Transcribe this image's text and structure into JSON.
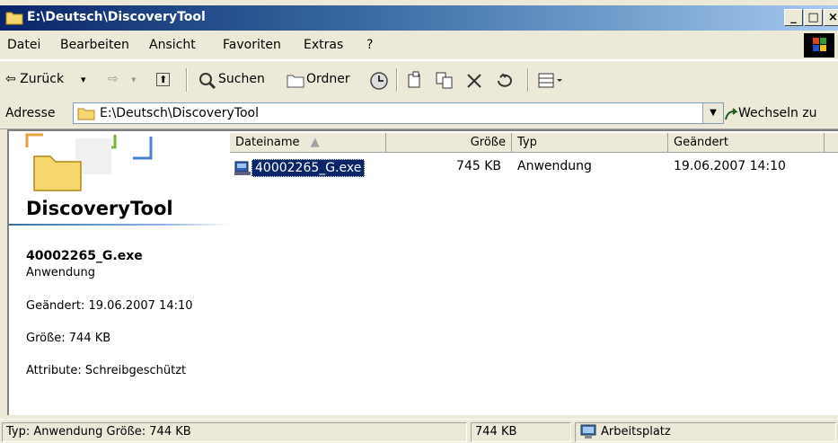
{
  "window": {
    "title": "E:\\Deutsch\\DiscoveryTool",
    "buttons": {
      "minimize": "_",
      "maximize": "□",
      "close": "×"
    }
  },
  "menu": [
    "Datei",
    "Bearbeiten",
    "Ansicht",
    "Favoriten",
    "Extras",
    "?"
  ],
  "toolbar": {
    "back": "⇦ Zurück",
    "back_arrow": "▾",
    "forward": "⇨",
    "forward_arrow": "▾",
    "up": "⬆",
    "search": "Suchen",
    "folders": "Ordner"
  },
  "address": {
    "label": "Adresse",
    "value": "E:\\Deutsch\\DiscoveryTool",
    "go": "Wechseln zu"
  },
  "details_pane": {
    "folder_title": "DiscoveryTool",
    "file_name": "40002265_G.exe",
    "file_type": "Anwendung",
    "modified": "Geändert: 19.06.2007 14:10",
    "size": "Größe: 744 KB",
    "attributes": "Attribute: Schreibgeschützt"
  },
  "columns": {
    "name": "Dateiname",
    "size": "Größe",
    "type": "Typ",
    "modified": "Geändert"
  },
  "files": [
    {
      "name": "40002265_G.exe",
      "size": "745 KB",
      "type": "Anwendung",
      "modified": "19.06.2007 14:10"
    }
  ],
  "status": {
    "info": "Typ: Anwendung Größe: 744 KB",
    "size": "744 KB",
    "location": "Arbeitsplatz"
  },
  "colors": {
    "titlebar_start": "#0a246a",
    "selection": "#0a246a",
    "chrome": "#ece9d8"
  }
}
